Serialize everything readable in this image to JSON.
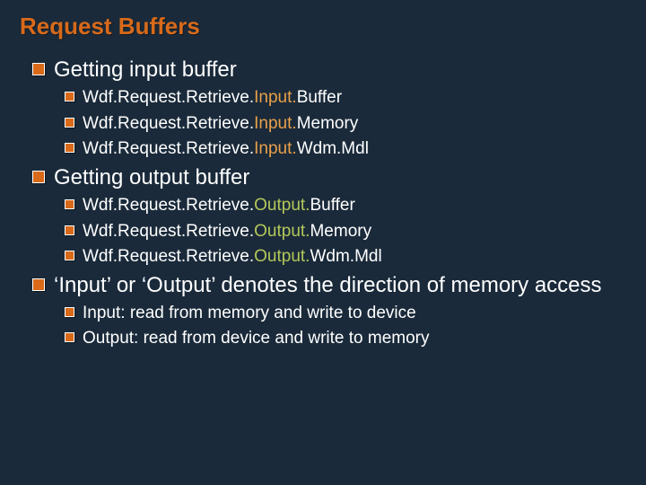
{
  "title": "Request Buffers",
  "sections": [
    {
      "heading": "Getting input buffer",
      "items": [
        {
          "prefix": "Wdf.Request.Retrieve.",
          "mid": "Input.",
          "midClass": "input-span",
          "suffix": "Buffer"
        },
        {
          "prefix": "Wdf.Request.Retrieve.",
          "mid": "Input.",
          "midClass": "input-span",
          "suffix": "Memory"
        },
        {
          "prefix": "Wdf.Request.Retrieve.",
          "mid": "Input.",
          "midClass": "input-span",
          "suffix": "Wdm.Mdl"
        }
      ]
    },
    {
      "heading": "Getting output buffer",
      "items": [
        {
          "prefix": "Wdf.Request.Retrieve.",
          "mid": "Output.",
          "midClass": "output-span",
          "suffix": "Buffer"
        },
        {
          "prefix": "Wdf.Request.Retrieve.",
          "mid": "Output.",
          "midClass": "output-span",
          "suffix": "Memory"
        },
        {
          "prefix": "Wdf.Request.Retrieve.",
          "mid": "Output.",
          "midClass": "output-span",
          "suffix": "Wdm.Mdl"
        }
      ]
    },
    {
      "heading": "‘Input’ or ‘Output’ denotes the direction of memory access",
      "items": [
        {
          "prefix": "Input: read from memory and write to device",
          "mid": "",
          "midClass": "",
          "suffix": ""
        },
        {
          "prefix": "Output: read from device and write to memory",
          "mid": "",
          "midClass": "",
          "suffix": ""
        }
      ]
    }
  ]
}
